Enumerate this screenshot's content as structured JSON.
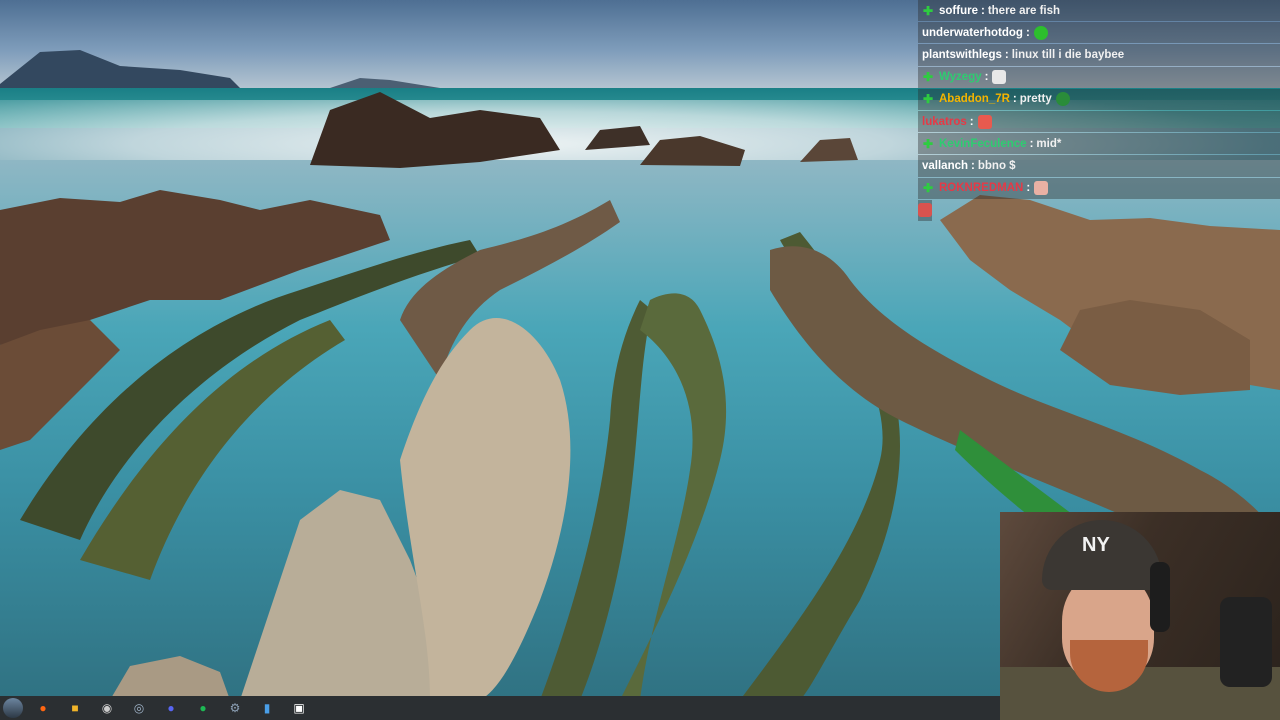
{
  "chat": {
    "messages": [
      {
        "badge": true,
        "user": "soffure",
        "color": "#ffffff",
        "message": "there are fish",
        "emote": null
      },
      {
        "badge": false,
        "user": "underwaterhotdog",
        "color": "#ffffff",
        "message": "",
        "emote": "#2dbf2d"
      },
      {
        "badge": false,
        "user": "plantswithlegs",
        "color": "#ffffff",
        "message": "linux till i die baybee",
        "emote": null
      },
      {
        "badge": true,
        "user": "Wyzegy",
        "color": "#2ecc71",
        "message": "",
        "emote": "#e8e8e8"
      },
      {
        "badge": true,
        "user": "Abaddon_7R",
        "color": "#f4b400",
        "message": "pretty",
        "emote": "#2a8c3a"
      },
      {
        "badge": false,
        "user": "lukatros",
        "color": "#e63946",
        "message": "",
        "emote": "#e85a4f"
      },
      {
        "badge": true,
        "user": "KevinFeculence",
        "color": "#2ecc71",
        "message": "mid*",
        "emote": null
      },
      {
        "badge": false,
        "user": "vallanch",
        "color": "#ffffff",
        "message": "bbno $",
        "emote": null
      },
      {
        "badge": true,
        "user": "ROKNREDMAN",
        "color": "#e63946",
        "message": "",
        "emote": "#e9b1a4"
      },
      {
        "badge": false,
        "user": "",
        "color": "#ffffff",
        "message": "",
        "emote": "#d9534f"
      }
    ]
  },
  "webcam": {
    "cap_logo": "NY"
  },
  "taskbar": {
    "icons": [
      {
        "name": "firefox-icon",
        "color": "#ff6611",
        "glyph": "●"
      },
      {
        "name": "folder-icon",
        "color": "#f0b429",
        "glyph": "■"
      },
      {
        "name": "obs-icon",
        "color": "#cccccc",
        "glyph": "◉"
      },
      {
        "name": "steam-icon",
        "color": "#9fb3c8",
        "glyph": "◎"
      },
      {
        "name": "discord-icon",
        "color": "#5865f2",
        "glyph": "●"
      },
      {
        "name": "spotify-icon",
        "color": "#1db954",
        "glyph": "●"
      },
      {
        "name": "settings-icon",
        "color": "#8fa3b8",
        "glyph": "⚙"
      },
      {
        "name": "document-icon",
        "color": "#4a9fe8",
        "glyph": "▮"
      },
      {
        "name": "app-icon",
        "color": "#ffffff",
        "glyph": "▣"
      }
    ]
  }
}
